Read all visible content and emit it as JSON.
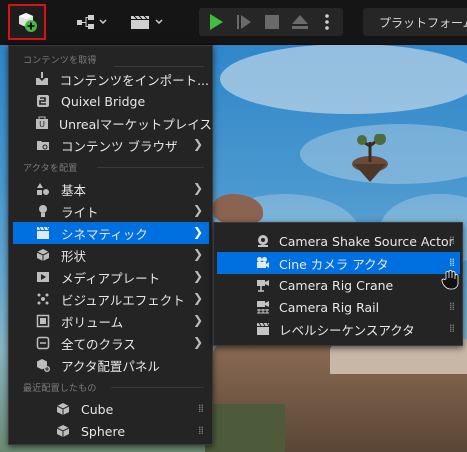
{
  "toolbar": {
    "play_icon_name": "play-icon",
    "platform_label": "プラットフォーム"
  },
  "menu": {
    "sections": {
      "get_content": "コンテンツを取得",
      "place_actors": "アクタを配置",
      "recently_placed": "最近配置したもの"
    },
    "items": [
      {
        "label": "コンテンツをインポート...",
        "icon": "import-icon"
      },
      {
        "label": "Quixel Bridge",
        "icon": "bridge-icon"
      },
      {
        "label": "Unrealマーケットプレイス",
        "icon": "marketplace-icon"
      },
      {
        "label": "コンテンツ ブラウザ",
        "icon": "folder-icon"
      },
      {
        "label": "基本",
        "icon": "shapes-icon"
      },
      {
        "label": "ライト",
        "icon": "light-icon"
      },
      {
        "label": "シネマティック",
        "icon": "clapper-icon"
      },
      {
        "label": "形状",
        "icon": "cube-icon"
      },
      {
        "label": "メディアプレート",
        "icon": "media-icon"
      },
      {
        "label": "ビジュアルエフェクト",
        "icon": "vfx-icon"
      },
      {
        "label": "ボリューム",
        "icon": "volume-icon"
      },
      {
        "label": "全てのクラス",
        "icon": "classes-icon"
      },
      {
        "label": "アクタ配置パネル",
        "icon": "panel-icon"
      },
      {
        "label": "Cube",
        "icon": "cube-icon"
      },
      {
        "label": "Sphere",
        "icon": "sphere-icon"
      }
    ]
  },
  "submenu": {
    "items": [
      {
        "label": "Camera Shake Source Actor"
      },
      {
        "label": "Cine カメラ アクタ"
      },
      {
        "label": "Camera Rig Crane"
      },
      {
        "label": "Camera Rig Rail"
      },
      {
        "label": "レベルシーケンスアクタ"
      }
    ]
  },
  "colors": {
    "selection": "#0070e0",
    "play_green": "#3fbf3f",
    "highlight_border": "#dd1111"
  }
}
